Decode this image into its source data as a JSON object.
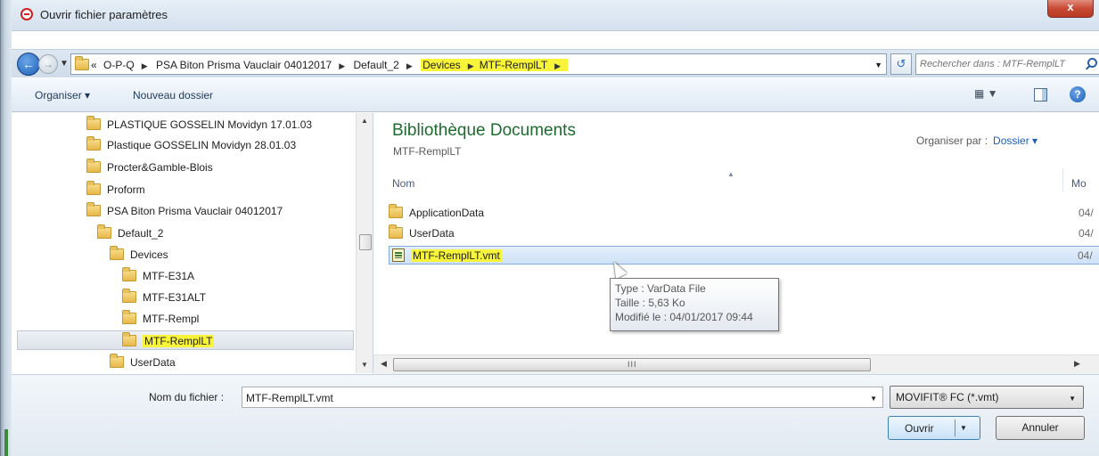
{
  "window": {
    "title": "Ouvrir fichier paramètres",
    "close_glyph": "x"
  },
  "address_bar": {
    "overflow": "«",
    "crumbs": [
      "O-P-Q",
      "PSA Biton Prisma Vauclair 04012017",
      "Default_2",
      "Devices",
      "MTF-RemplLT"
    ],
    "search_placeholder": "Rechercher dans : MTF-RemplLT"
  },
  "toolbar": {
    "organise_label": "Organiser ▾",
    "new_folder_label": "Nouveau dossier"
  },
  "nav_pane": {
    "items": [
      {
        "label": "PLASTIQUE GOSSELIN Movidyn 17.01.03",
        "level": 0
      },
      {
        "label": "Plastique GOSSELIN Movidyn 28.01.03",
        "level": 0
      },
      {
        "label": "Procter&Gamble-Blois",
        "level": 0
      },
      {
        "label": "Proform",
        "level": 0
      },
      {
        "label": "PSA Biton Prisma Vauclair 04012017",
        "level": 0
      },
      {
        "label": "Default_2",
        "level": 1
      },
      {
        "label": "Devices",
        "level": 2
      },
      {
        "label": "MTF-E31A",
        "level": 3
      },
      {
        "label": "MTF-E31ALT",
        "level": 3
      },
      {
        "label": "MTF-Rempl",
        "level": 3
      },
      {
        "label": "MTF-RemplLT",
        "level": 3,
        "selected": true
      },
      {
        "label": "UserData",
        "level": 2
      }
    ]
  },
  "content": {
    "library_title": "Bibliothèque Documents",
    "library_subtitle": "MTF-RemplLT",
    "arrange_label": "Organiser par :",
    "arrange_value": "Dossier ▾",
    "columns": {
      "name": "Nom",
      "modified": "Mo"
    },
    "files": [
      {
        "name": "ApplicationData",
        "date": "04/",
        "type": "folder"
      },
      {
        "name": "UserData",
        "date": "04/",
        "type": "folder"
      },
      {
        "name": "MTF-RemplLT.vmt",
        "date": "04/",
        "type": "vmt",
        "selected": true
      }
    ],
    "tooltip": {
      "type": "Type : VarData File",
      "size": "Taille : 5,63 Ko",
      "modified": "Modifié le : 04/01/2017 09:44"
    }
  },
  "bottom": {
    "filename_label": "Nom du fichier :",
    "filename_value": "MTF-RemplLT.vmt",
    "filetype_value": "MOVIFIT® FC (*.vmt)",
    "open_label": "Ouvrir",
    "cancel_label": "Annuler"
  },
  "colors": {
    "library_title": "#1e6b2e",
    "highlight": "#f7f43a",
    "selection": "#cfe2f7"
  }
}
